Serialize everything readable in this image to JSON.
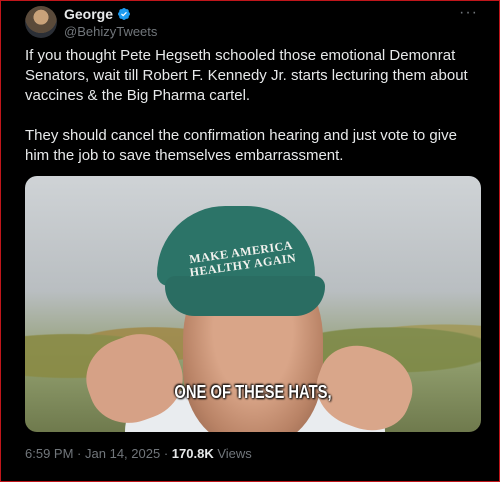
{
  "author": {
    "name": "George",
    "handle": "@BehizyTweets",
    "verified": true
  },
  "menu": {
    "more_label": "···"
  },
  "tweet": {
    "paragraphs": [
      "If you thought Pete Hegseth schooled those emotional Demonrat Senators, wait till Robert F. Kennedy Jr. starts lecturing them about vaccines & the Big Pharma cartel.",
      "They should cancel the confirmation hearing and just vote to give him the job to save themselves embarrassment."
    ]
  },
  "media": {
    "hat_text_line1": "MAKE AMERICA",
    "hat_text_line2": "HEALTHY AGAIN",
    "caption": "ONE OF THESE HATS,"
  },
  "meta": {
    "time": "6:59 PM",
    "separator": "·",
    "date": "Jan 14, 2025",
    "views_count": "170.8K",
    "views_label": "Views"
  },
  "colors": {
    "background": "#000000",
    "text_primary": "#e7e9ea",
    "text_secondary": "#71767b",
    "verified_blue": "#1d9bf0",
    "frame_border": "#c0161b"
  }
}
